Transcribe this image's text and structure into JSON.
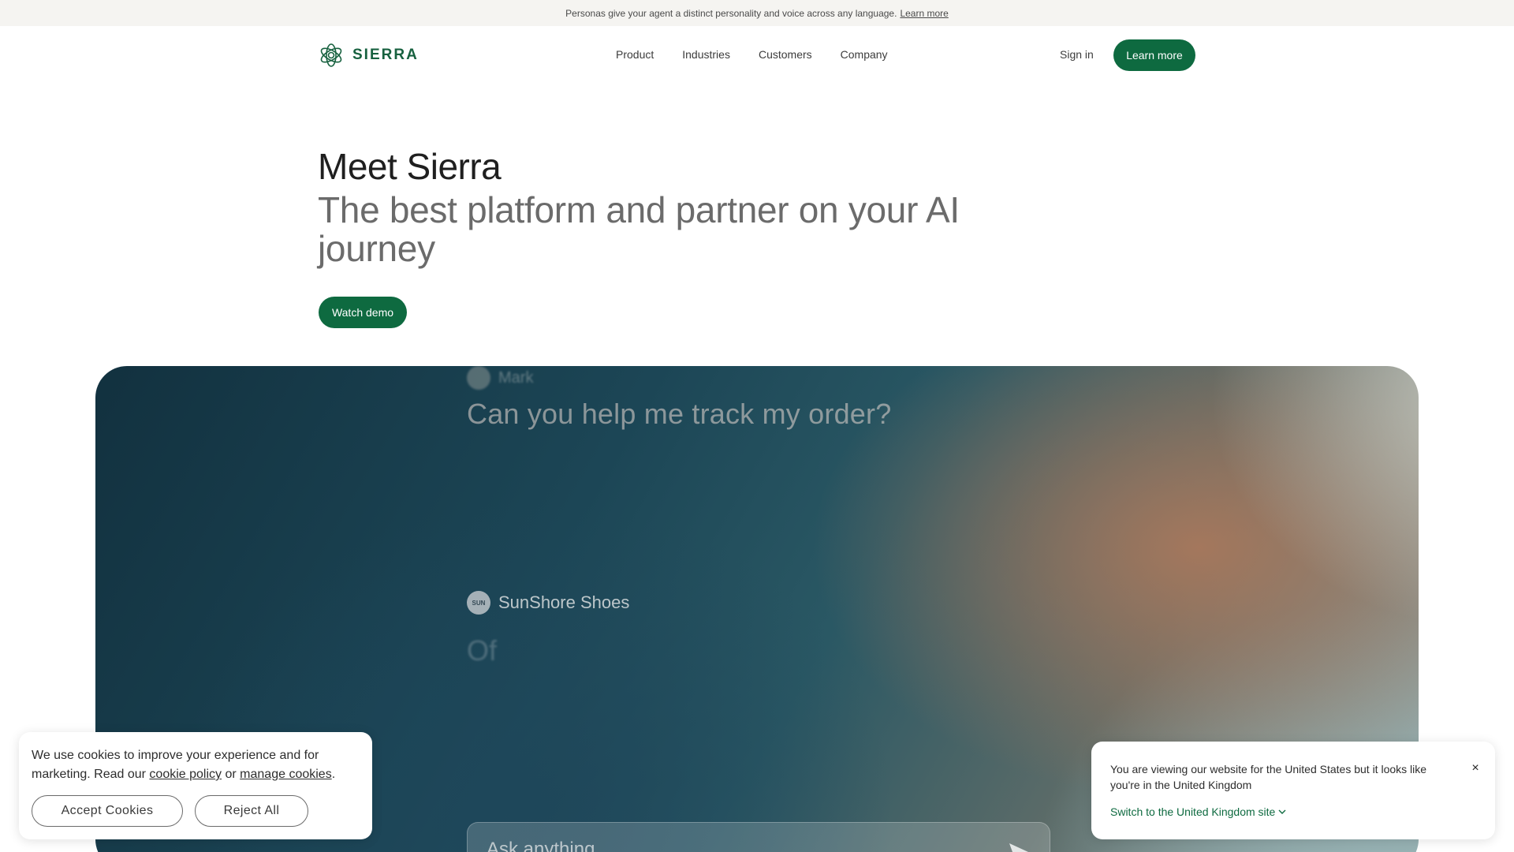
{
  "announcement": {
    "text": "Personas give your agent a distinct personality and voice across any language.",
    "link": "Learn more"
  },
  "nav": {
    "logo_text": "SIERRA",
    "links": [
      "Product",
      "Industries",
      "Customers",
      "Company"
    ],
    "sign_in": "Sign in",
    "cta": "Learn more"
  },
  "hero": {
    "title": "Meet Sierra",
    "subtitle": "The best platform and partner on your AI journey",
    "cta": "Watch demo"
  },
  "demo": {
    "user_name": "Mark",
    "question": "Can you help me track my order?",
    "brand_badge": "SUN",
    "brand_name": "SunShore Shoes",
    "typing": "Of",
    "input_placeholder": "Ask anything"
  },
  "cookie_banner": {
    "text_before": "We use cookies to improve your experience and for marketing. Read our",
    "cookie_policy": "cookie policy",
    "or": "or",
    "manage_cookies": "manage cookies",
    "period": ".",
    "accept": "Accept Cookies",
    "reject": "Reject All"
  },
  "region_banner": {
    "message": "You are viewing our website for the United States but it looks like you're in the United Kingdom",
    "switch_link": "Switch to the United Kingdom site",
    "close": "×"
  },
  "colors": {
    "brand_green": "#0e6a40",
    "logo_green": "#17613f",
    "announcement_bg": "#f5f4f1"
  }
}
